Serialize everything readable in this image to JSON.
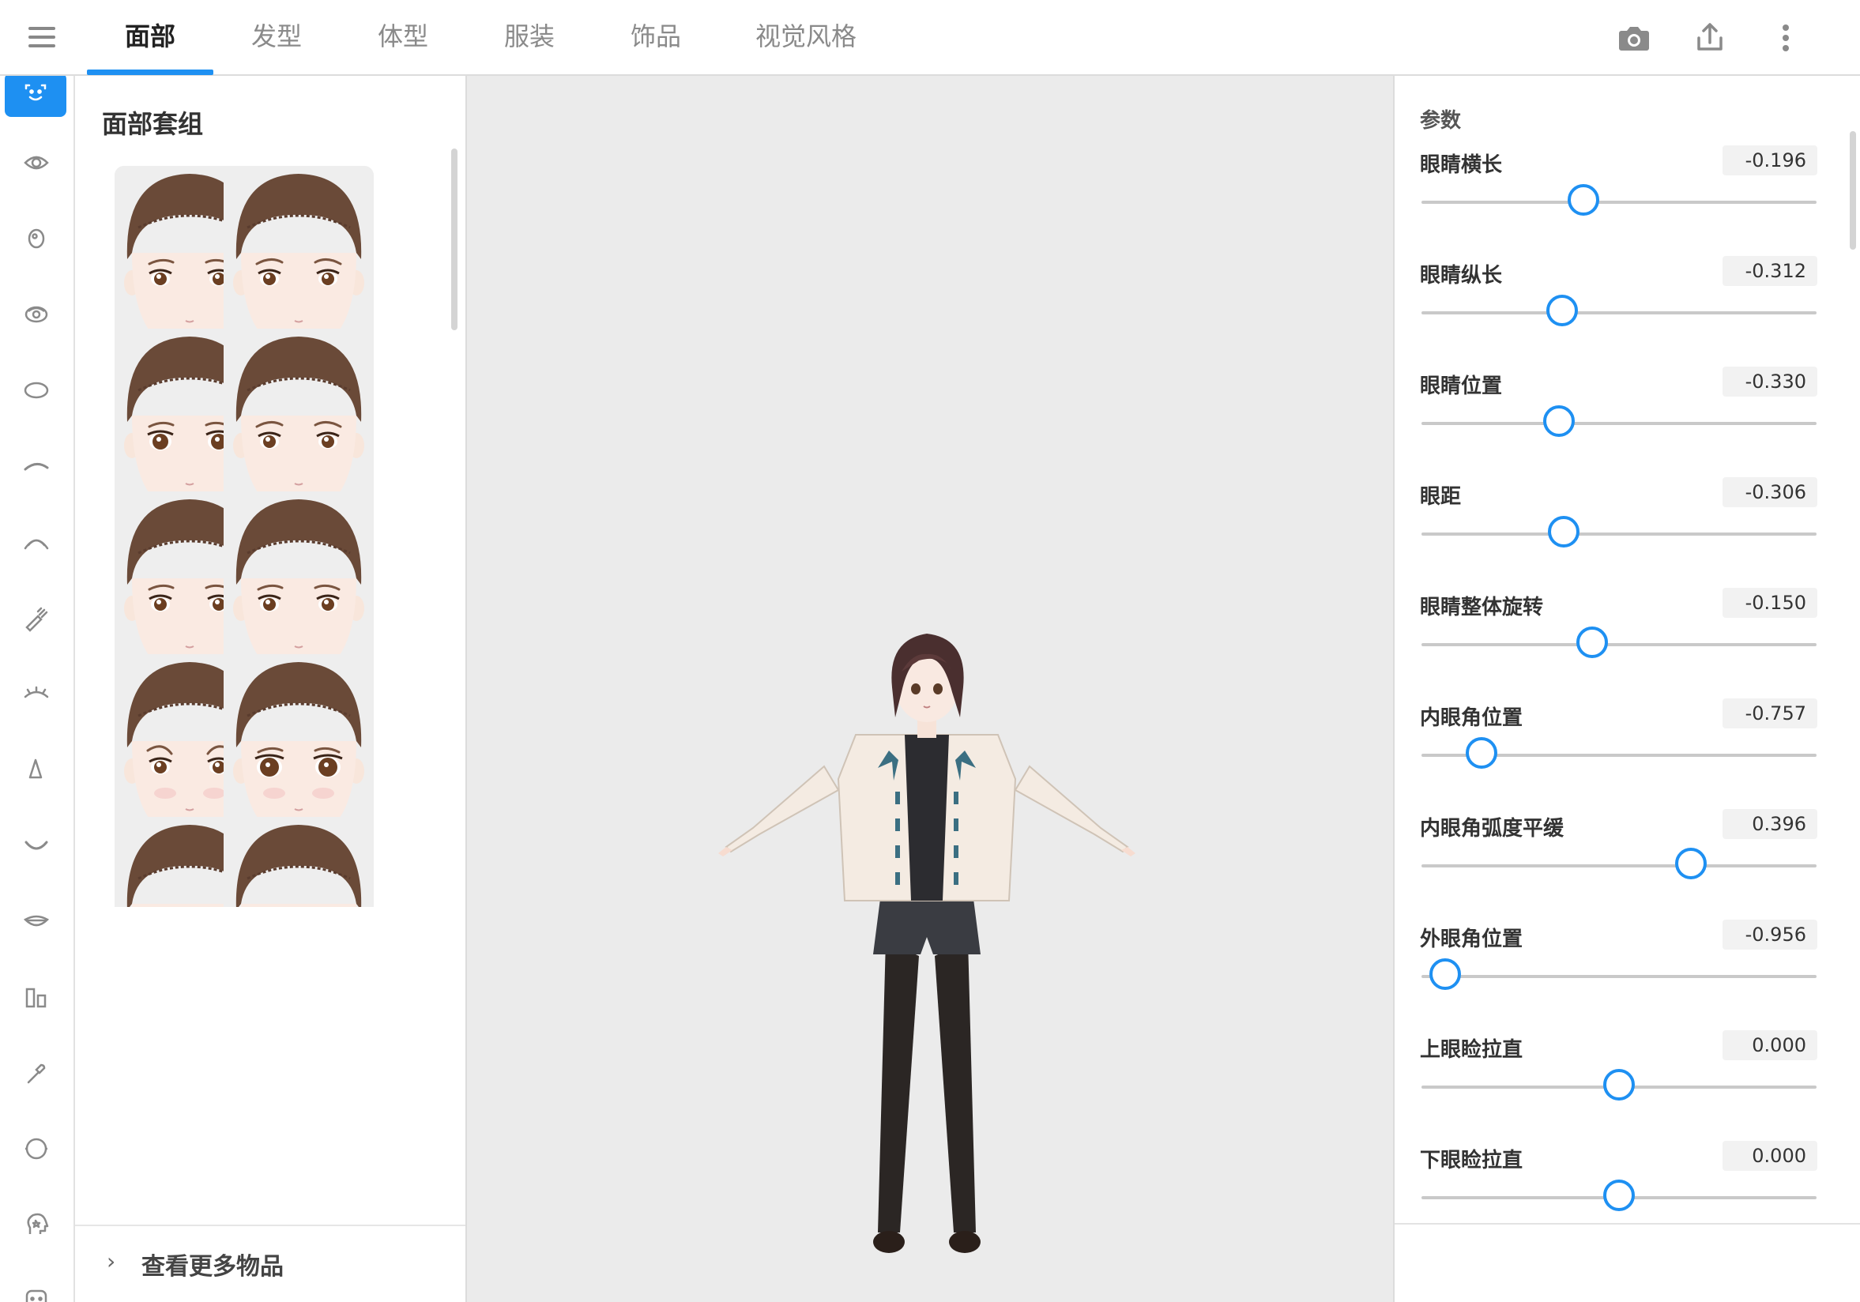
{
  "topbar": {
    "tabs": [
      {
        "label": "面部",
        "active": true
      },
      {
        "label": "发型",
        "active": false
      },
      {
        "label": "体型",
        "active": false
      },
      {
        "label": "服装",
        "active": false
      },
      {
        "label": "饰品",
        "active": false
      },
      {
        "label": "视觉风格",
        "active": false
      }
    ],
    "actions": [
      "camera-icon",
      "share-icon",
      "more-vert-icon"
    ]
  },
  "rail": {
    "items": [
      "face-icon",
      "eye-icon",
      "iris-icon",
      "eye-highlight-icon",
      "eye-shape-icon",
      "eyebrow-icon",
      "eyelash-icon",
      "makeup-brush-icon",
      "lower-lash-icon",
      "nose-icon",
      "mouth-icon",
      "lips-icon",
      "teeth-icon",
      "brush-icon",
      "head-outline-icon",
      "face-sticker-icon",
      "emote-icon"
    ],
    "active_index": 0
  },
  "faceset": {
    "title": "面部套组",
    "check_mark": "✔",
    "items": [
      {
        "selected": true,
        "variant": "neutral"
      },
      {
        "selected": true,
        "variant": "narrow"
      },
      {
        "selected": true,
        "variant": "sparkle"
      },
      {
        "selected": true,
        "variant": "sharp"
      },
      {
        "selected": true,
        "variant": "soft"
      },
      {
        "selected": true,
        "variant": "calm"
      },
      {
        "selected": true,
        "variant": "worried"
      },
      {
        "selected": true,
        "variant": "bigeye"
      },
      {
        "selected": false,
        "variant": "neutral"
      },
      {
        "selected": false,
        "variant": "neutral"
      }
    ],
    "more_label": "查看更多物品",
    "more_chevron": "›"
  },
  "params": {
    "title": "参数",
    "items": [
      {
        "label": "眼睛横长",
        "value": -0.196,
        "display": "-0.196"
      },
      {
        "label": "眼睛纵长",
        "value": -0.312,
        "display": "-0.312"
      },
      {
        "label": "眼睛位置",
        "value": -0.33,
        "display": "-0.330"
      },
      {
        "label": "眼距",
        "value": -0.306,
        "display": "-0.306"
      },
      {
        "label": "眼睛整体旋转",
        "value": -0.15,
        "display": "-0.150"
      },
      {
        "label": "内眼角位置",
        "value": -0.757,
        "display": "-0.757"
      },
      {
        "label": "内眼角弧度平缓",
        "value": 0.396,
        "display": "0.396"
      },
      {
        "label": "外眼角位置",
        "value": -0.956,
        "display": "-0.956"
      },
      {
        "label": "上眼睑拉直",
        "value": 0.0,
        "display": "0.000"
      },
      {
        "label": "下眼睑拉直",
        "value": 0.0,
        "display": "0.000"
      }
    ]
  },
  "colors": {
    "accent": "#1e90f2",
    "panel": "#ffffff",
    "viewport": "#ebebeb"
  }
}
